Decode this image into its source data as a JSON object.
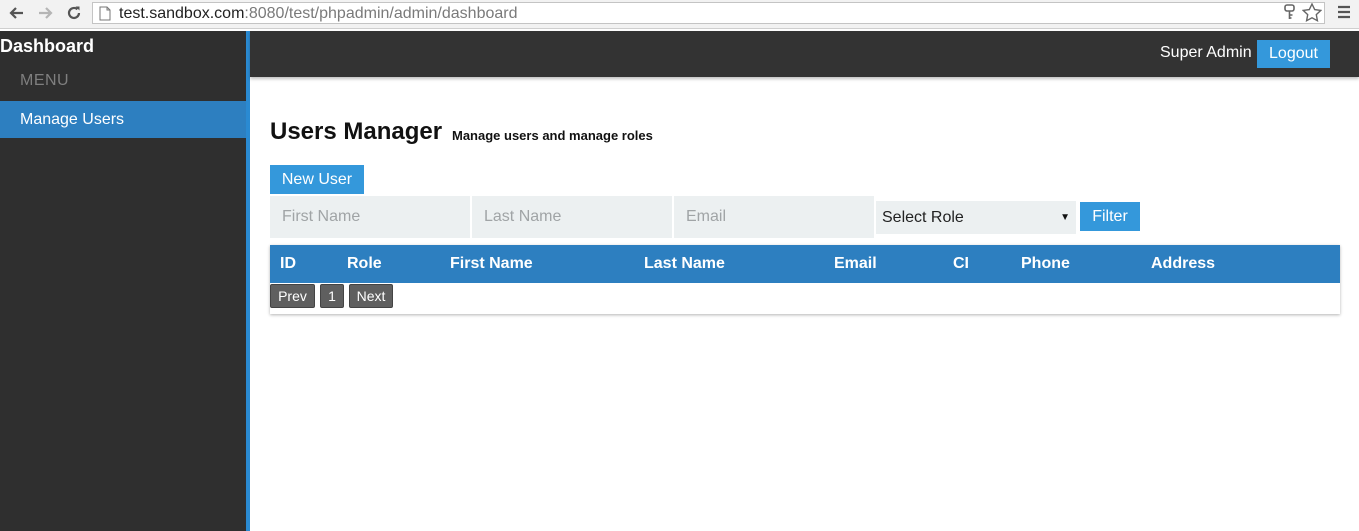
{
  "browser": {
    "url_host": "test.sandbox.com",
    "url_rest": ":8080/test/phpadmin/admin/dashboard"
  },
  "sidebar": {
    "brand": "Dashboard",
    "menu_label": "MENU",
    "items": [
      {
        "label": "Manage Users",
        "active": true
      }
    ]
  },
  "topbar": {
    "user_name": "Super Admin",
    "logout_label": "Logout"
  },
  "page": {
    "title": "Users Manager",
    "subtitle": "Manage users and manage roles",
    "new_user_label": "New User"
  },
  "filters": {
    "first_name_placeholder": "First Name",
    "last_name_placeholder": "Last Name",
    "email_placeholder": "Email",
    "role_select_value": "Select Role",
    "filter_label": "Filter"
  },
  "table": {
    "columns": [
      "ID",
      "Role",
      "First Name",
      "Last Name",
      "Email",
      "CI",
      "Phone",
      "Address"
    ]
  },
  "pagination": {
    "prev_label": "Prev",
    "current_page": "1",
    "next_label": "Next"
  },
  "colors": {
    "accent": "#3498db",
    "header_blue": "#2d7fc0",
    "sidebar_bg": "#2f2f2f",
    "topbar_bg": "#333333"
  }
}
